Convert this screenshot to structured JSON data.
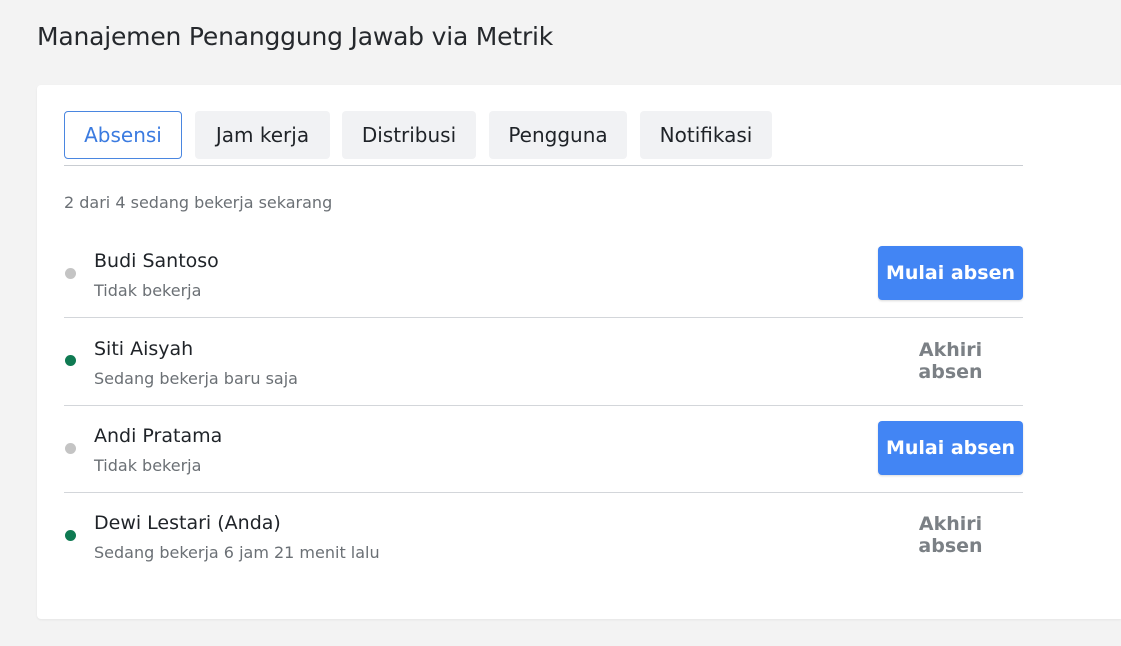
{
  "page": {
    "title": "Manajemen Penanggung Jawab via Metrik"
  },
  "tabs": [
    {
      "label": "Absensi",
      "active": true
    },
    {
      "label": "Jam kerja",
      "active": false
    },
    {
      "label": "Distribusi",
      "active": false
    },
    {
      "label": "Pengguna",
      "active": false
    },
    {
      "label": "Notifikasi",
      "active": false
    }
  ],
  "summary": "2 dari 4 sedang bekerja sekarang",
  "users": [
    {
      "name": "Budi Santoso",
      "status": "Tidak bekerja",
      "working": false,
      "action_label": "Mulai absen"
    },
    {
      "name": "Siti Aisyah",
      "status": "Sedang bekerja baru saja",
      "working": true,
      "action_label": "Akhiri absen"
    },
    {
      "name": "Andi Pratama",
      "status": "Tidak bekerja",
      "working": false,
      "action_label": "Mulai absen"
    },
    {
      "name": "Dewi Lestari (Anda)",
      "status": "Sedang bekerja 6 jam 21 menit lalu",
      "working": true,
      "action_label": "Akhiri absen"
    }
  ],
  "colors": {
    "accent": "#4285f4",
    "working_dot": "#0f7a52",
    "idle_dot": "#c4c4c4",
    "muted_action": "#7b8085"
  }
}
